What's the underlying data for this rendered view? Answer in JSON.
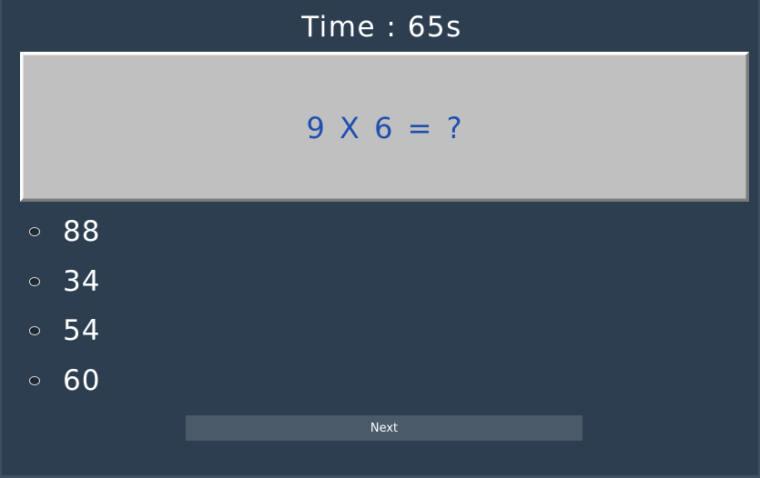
{
  "timer": {
    "text": "Time : 65s"
  },
  "question": {
    "text": "9 X 6 = ?"
  },
  "options": [
    {
      "label": "88"
    },
    {
      "label": "34"
    },
    {
      "label": "54"
    },
    {
      "label": "60"
    }
  ],
  "next_button": {
    "label": "Next"
  },
  "colors": {
    "background": "#2c3e50",
    "question_panel": "#c0c0c0",
    "question_text": "#1f4fb0",
    "button": "#4b5a69",
    "text": "#ffffff"
  }
}
